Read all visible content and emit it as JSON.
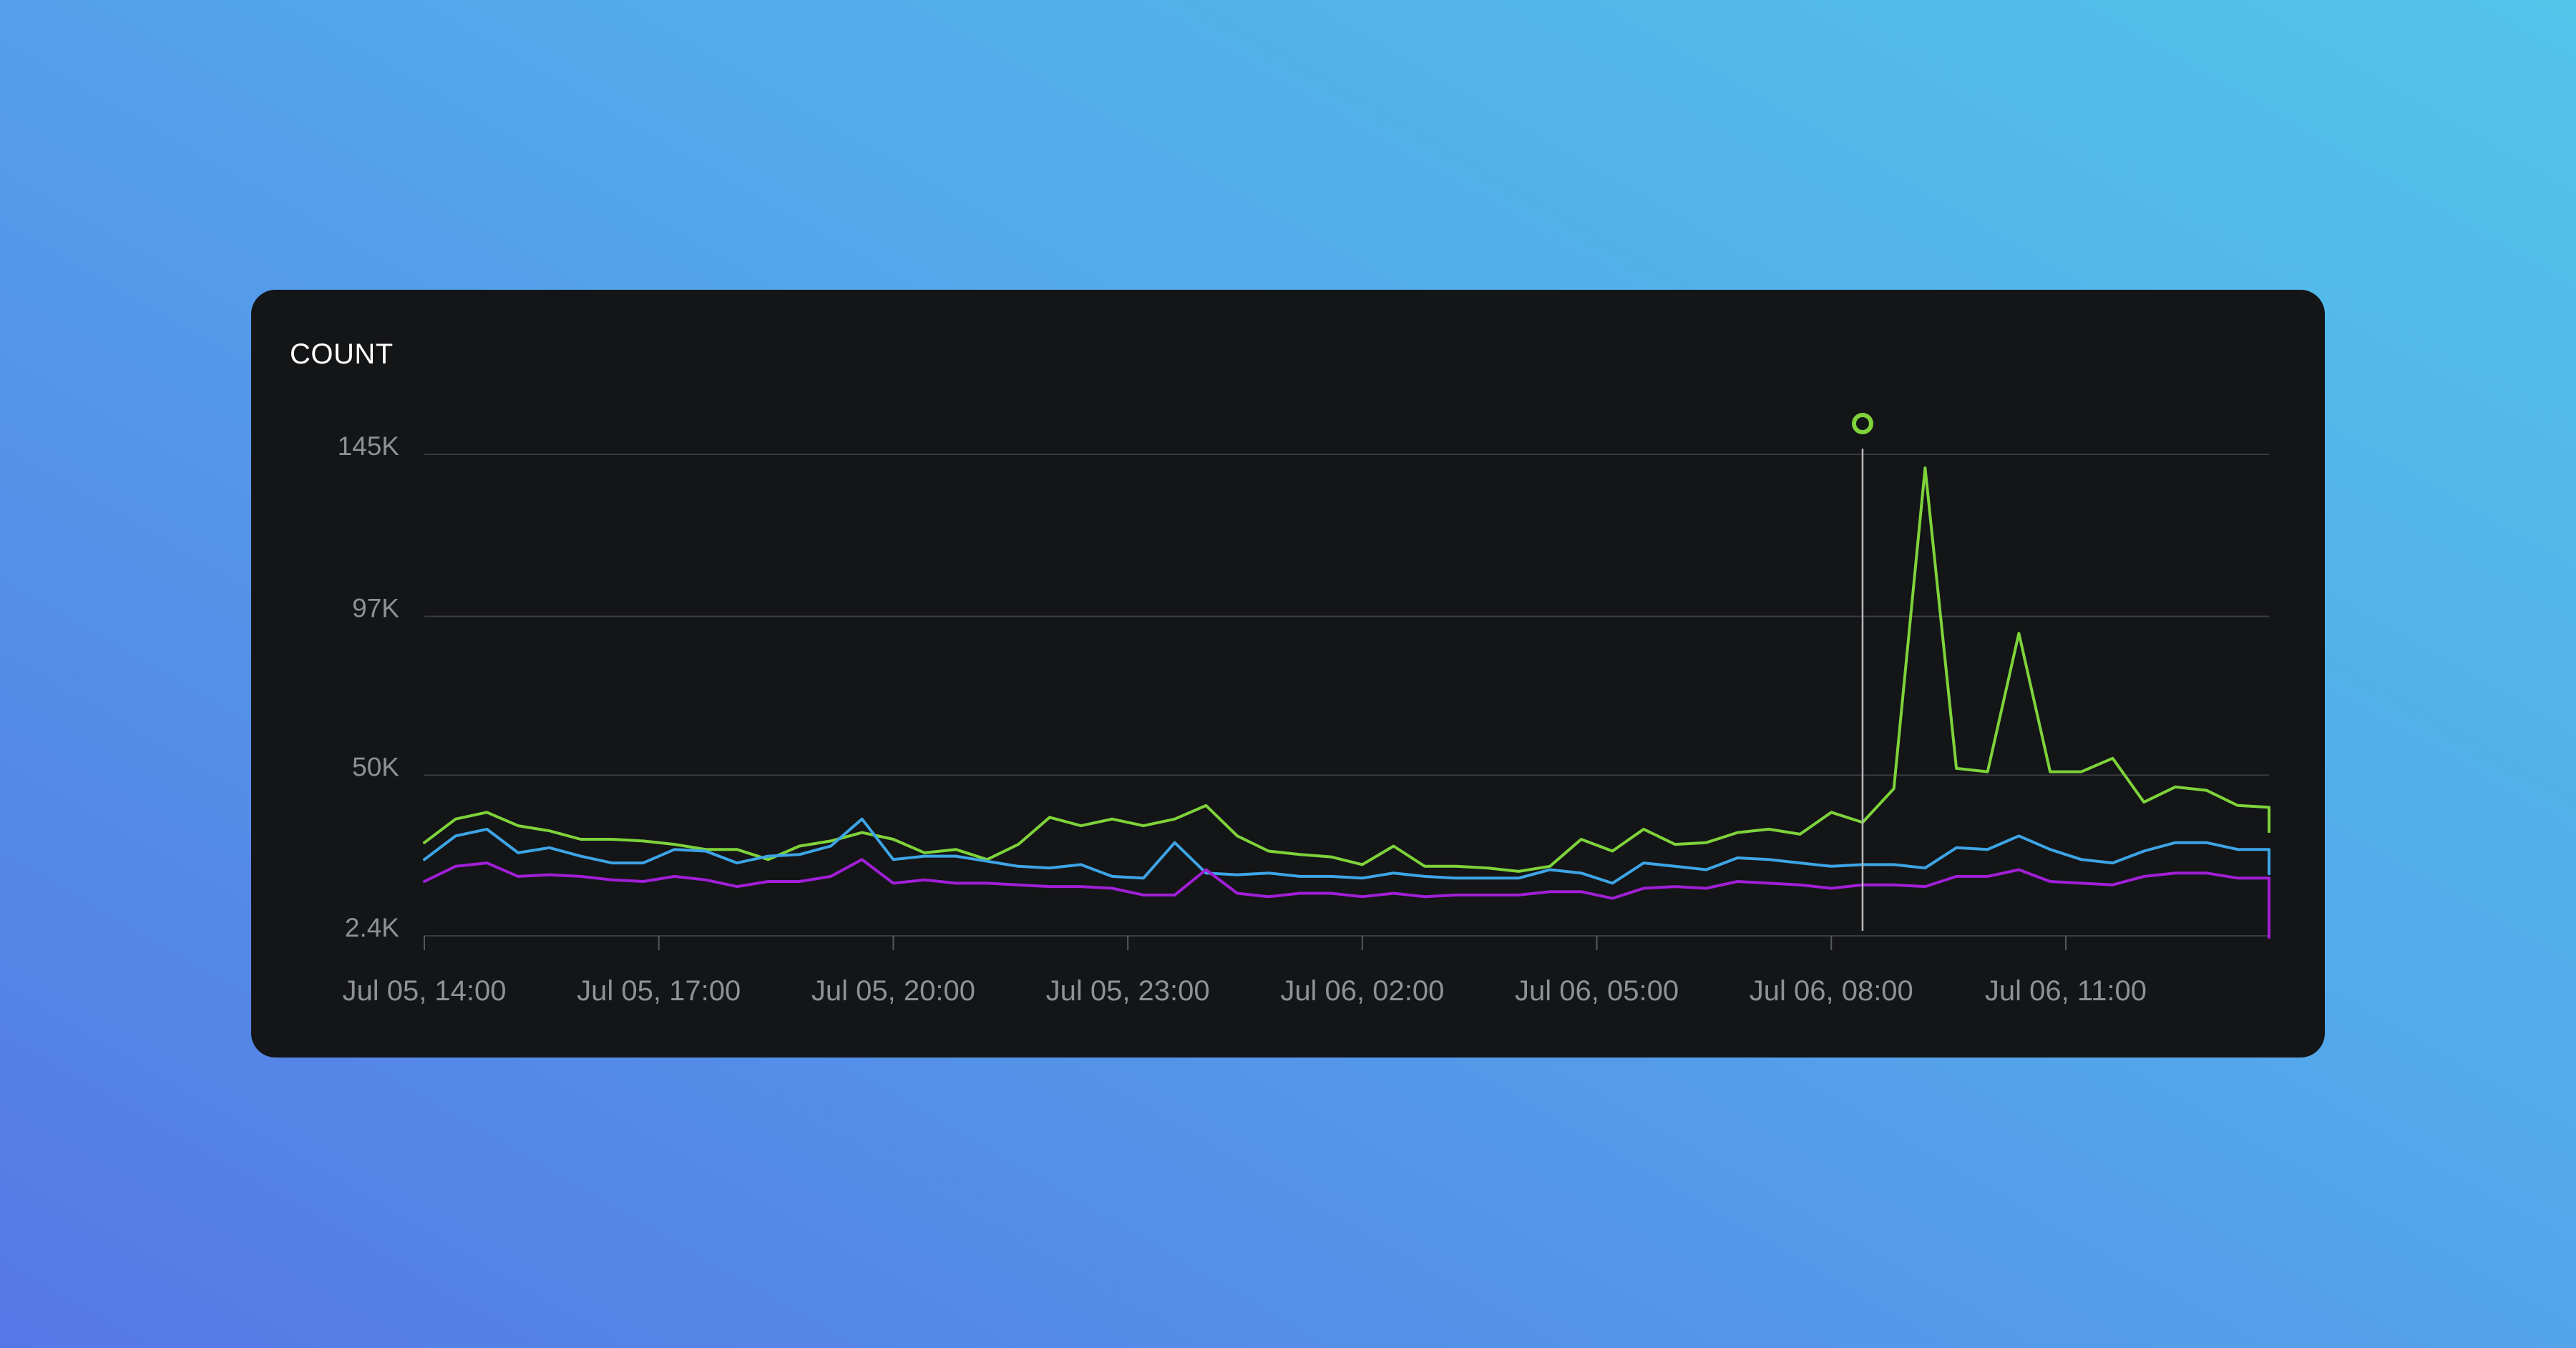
{
  "chart_data": {
    "type": "line",
    "title": "COUNT",
    "xlabel": "",
    "ylabel": "",
    "ylim": [
      2400,
      145000
    ],
    "yticks": [
      {
        "value": 145000,
        "label": "145K"
      },
      {
        "value": 97000,
        "label": "97K"
      },
      {
        "value": 50000,
        "label": "50K"
      },
      {
        "value": 2400,
        "label": "2.4K"
      }
    ],
    "xtick_labels": [
      "Jul 05, 14:00",
      "Jul 05, 17:00",
      "Jul 05, 20:00",
      "Jul 05, 23:00",
      "Jul 06, 02:00",
      "Jul 06, 05:00",
      "Jul 06, 08:00",
      "Jul 06, 11:00"
    ],
    "x_start": "Jul 05, 14:00",
    "x_step_minutes": 24,
    "grid": true,
    "legend": "none",
    "cursor": {
      "x": "Jul 06, 08:24"
    },
    "series": [
      {
        "color": "#7ed33a",
        "values": [
          30000,
          37000,
          39000,
          35000,
          33500,
          31000,
          31000,
          30500,
          29500,
          28000,
          28000,
          25000,
          29000,
          30500,
          33000,
          31000,
          27000,
          28000,
          25000,
          29500,
          37500,
          35000,
          37000,
          35000,
          37000,
          41000,
          32000,
          27500,
          26500,
          25800,
          23500,
          29000,
          23000,
          23000,
          22500,
          21500,
          23000,
          31000,
          27500,
          34000,
          29500,
          30000,
          33000,
          34000,
          32500,
          39000,
          36000,
          46000,
          141000,
          52000,
          51000,
          92000,
          51000,
          51000,
          55000,
          42000,
          46500,
          45500,
          41000,
          40500
        ]
      },
      {
        "color": "#3da5e6",
        "values": [
          25000,
          32000,
          34000,
          27000,
          28500,
          26000,
          24000,
          24000,
          28000,
          27500,
          24000,
          26000,
          26500,
          29000,
          37000,
          25000,
          26000,
          26000,
          24500,
          23000,
          22500,
          23500,
          20000,
          19500,
          30000,
          21000,
          20500,
          21000,
          20000,
          20000,
          19500,
          21000,
          20000,
          19500,
          19500,
          19500,
          22000,
          21000,
          18000,
          24000,
          23000,
          22000,
          25500,
          25000,
          24000,
          23000,
          23500,
          23500,
          22500,
          28500,
          28000,
          32000,
          28000,
          25000,
          24000,
          27500,
          30000,
          30000,
          28000,
          28000
        ]
      },
      {
        "color": "#a11fd6",
        "values": [
          18500,
          23000,
          24000,
          20000,
          20500,
          20000,
          19000,
          18500,
          20000,
          19000,
          17000,
          18500,
          18500,
          20000,
          25000,
          18000,
          19000,
          18000,
          18000,
          17500,
          17000,
          17000,
          16500,
          14500,
          14500,
          22000,
          15000,
          14000,
          15000,
          15000,
          14000,
          15000,
          14000,
          14500,
          14500,
          14500,
          15500,
          15500,
          13500,
          16500,
          17000,
          16500,
          18500,
          18000,
          17500,
          16500,
          17500,
          17500,
          17000,
          20000,
          20000,
          22000,
          18500,
          18000,
          17500,
          20000,
          21000,
          21000,
          19500,
          19500
        ]
      }
    ]
  }
}
